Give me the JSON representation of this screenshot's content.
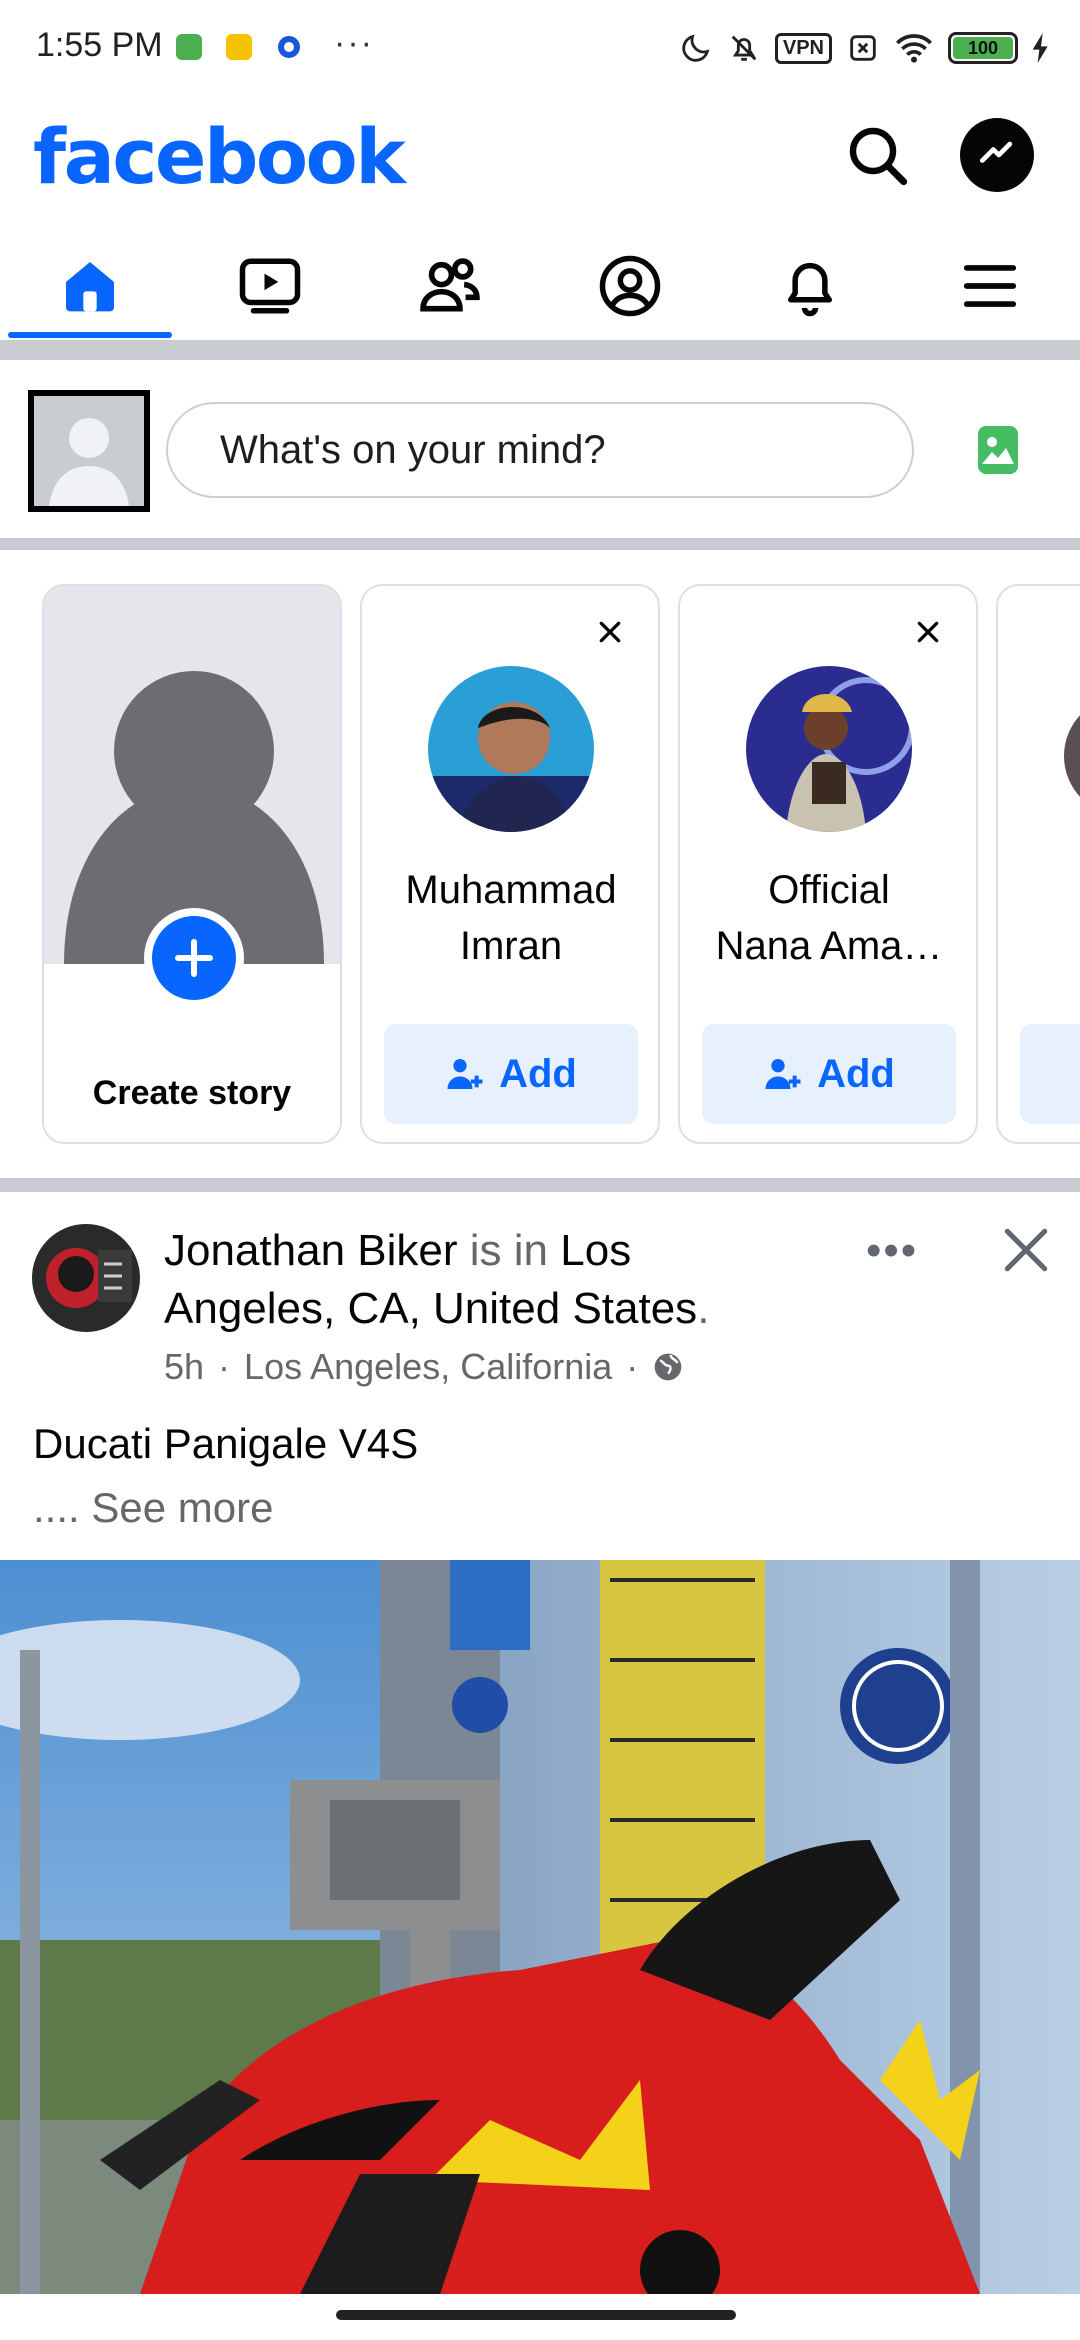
{
  "status_bar": {
    "time": "1:55 PM",
    "dots": "···",
    "vpn": "VPN",
    "battery": "100"
  },
  "header": {
    "logo": "facebook",
    "icons": [
      "search-icon",
      "messenger-icon"
    ]
  },
  "tabs": [
    {
      "name": "home",
      "icon": "home-icon",
      "active": true
    },
    {
      "name": "video",
      "icon": "video-icon",
      "active": false
    },
    {
      "name": "friends",
      "icon": "friends-icon",
      "active": false
    },
    {
      "name": "profile",
      "icon": "profile-icon",
      "active": false
    },
    {
      "name": "notifications",
      "icon": "bell-icon",
      "active": false
    },
    {
      "name": "menu",
      "icon": "menu-icon",
      "active": false
    }
  ],
  "composer": {
    "placeholder": "What's on your mind?"
  },
  "stories": {
    "create_label": "Create story",
    "suggestions": [
      {
        "name": "Muhammad Imran",
        "line1": "Muhammad",
        "line2": "Imran",
        "button": "Add"
      },
      {
        "name": "Official Nana Ama…",
        "line1": "Official",
        "line2": "Nana Ama…",
        "button": "Add"
      }
    ]
  },
  "post": {
    "author": "Jonathan Biker",
    "connector": "is in",
    "location": "Los Angeles, CA, United States",
    "period": ".",
    "time": "5h",
    "place": "Los Angeles, California",
    "meta_sep": "·",
    "text": "Ducati Panigale V4S",
    "see_more_prefix": "....",
    "see_more": "See more"
  },
  "colors": {
    "brand": "#0866ff",
    "divider": "#c9ccd1",
    "secondary_text": "#65676b",
    "add_button_bg": "#e7f0fd"
  }
}
